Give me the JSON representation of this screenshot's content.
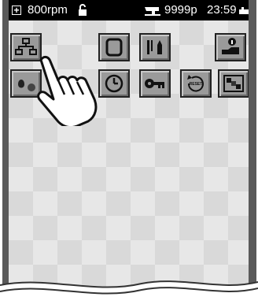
{
  "status_bar": {
    "speed": "800rpm",
    "stitch_count": "9999p",
    "time": "23:59"
  },
  "buttons": [
    {
      "name": "network-button",
      "icon": "network-icon"
    },
    {
      "name": "frame-button",
      "icon": "square-frame-icon"
    },
    {
      "name": "needle-bobbin-button",
      "icon": "needle-bobbin-icon"
    },
    {
      "name": "operator-info-button",
      "icon": "operator-info-icon"
    },
    {
      "name": "thread-color-button",
      "icon": "thread-icon"
    },
    {
      "name": "timer-button",
      "icon": "clock-icon"
    },
    {
      "name": "key-button",
      "icon": "key-icon"
    },
    {
      "name": "reset-button",
      "icon": "reset-icon",
      "label": "RESET"
    },
    {
      "name": "pattern-button",
      "icon": "pattern-icon"
    }
  ]
}
